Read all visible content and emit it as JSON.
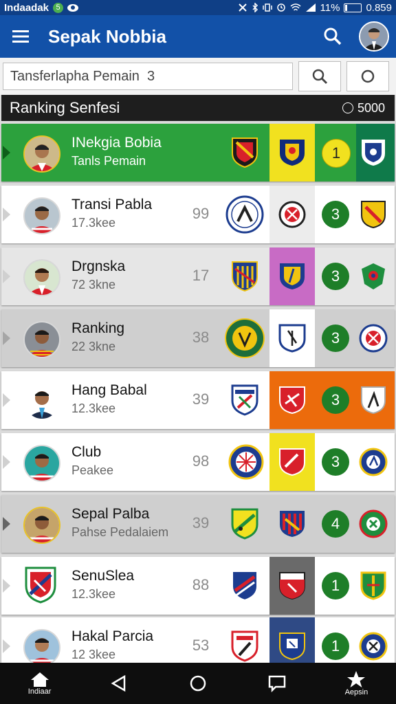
{
  "statusbar": {
    "carrier": "Indaadak",
    "badge": "5",
    "battery_pct": "11%",
    "time": "0.859",
    "icons": [
      "nfc-icon",
      "bluetooth-icon",
      "vibrate-icon",
      "alarm-icon",
      "wifi-icon",
      "signal-icon",
      "battery-icon"
    ]
  },
  "appbar": {
    "title": "Sepak Nobbia",
    "menu_icon": "hamburger-icon",
    "search_icon": "search-icon"
  },
  "search": {
    "value": "Tansferlapha Pemain  3"
  },
  "header": {
    "title": "Ranking Senfesi",
    "coins": "5000"
  },
  "colors": {
    "primary": "#1251a8",
    "status": "#0f3f86",
    "highlight_green": "#2ca13d",
    "rank_green": "#1e7e28",
    "yellow": "#f1e11f",
    "orange": "#ec6b0c",
    "purple": "#c86bc5",
    "darkgrey": "#6a6a6a",
    "navy": "#2f4a85"
  },
  "rows": [
    {
      "name": "INekgia Bobia",
      "sub": "Tanls Pemain",
      "score": "",
      "rank": "1"
    },
    {
      "name": "Transi Pabla",
      "sub": "17.3kee",
      "score": "99",
      "rank": "3"
    },
    {
      "name": "Drgnska",
      "sub": "72 3kne",
      "score": "17",
      "rank": "3"
    },
    {
      "name": "Ranking",
      "sub": "22 3kne",
      "score": "38",
      "rank": "3"
    },
    {
      "name": "Hang Babal",
      "sub": "12.3kee",
      "score": "39",
      "rank": "3"
    },
    {
      "name": "Club",
      "sub": "Peakee",
      "score": "98",
      "rank": "3"
    },
    {
      "name": "Sepal Palba",
      "sub": "Pahse Pedalaiem",
      "score": "39",
      "rank": "4"
    },
    {
      "name": "SenuSlea",
      "sub": "12.3kee",
      "score": "88",
      "rank": "1"
    },
    {
      "name": "Hakal Parcia",
      "sub": "12 3kee",
      "score": "53",
      "rank": "1"
    }
  ],
  "nav": {
    "home_label": "Indiaar",
    "star_label": "Aepsin"
  }
}
